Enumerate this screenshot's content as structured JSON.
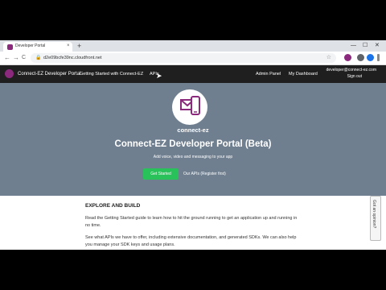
{
  "browser": {
    "tab_title": "Developer Portal",
    "tab_close": "×",
    "new_tab": "+",
    "win_min": "—",
    "win_max": "☐",
    "win_close": "✕",
    "back": "←",
    "forward": "→",
    "reload": "C",
    "url": "d2e09bcfe39nc.cloudfront.net",
    "lock_icon": "🔒",
    "star_icon": "☆"
  },
  "site_nav": {
    "brand": "Connect-EZ Developer Portal",
    "getting_started": "Getting Started with Connect-EZ",
    "apis": "APIs",
    "admin_panel": "Admin Panel",
    "my_dashboard": "My Dashboard",
    "user_email": "developer@connect-ez.com",
    "sign_out": "Sign out"
  },
  "hero": {
    "brand_label": "connect-ez",
    "title": "Connect-EZ Developer Portal (Beta)",
    "subtitle": "Add voice, video and messaging to your app",
    "get_started": "Get Started",
    "apis_link": "Our APIs (Register first)"
  },
  "content": {
    "heading": "EXPLORE AND BUILD",
    "para1": "Read the Getting Started guide to learn how to hit the ground running to get an application up and running in no time.",
    "para2": "See what APIs we have to offer, including extensive documentation, and generated SDKs. We can also help you manage your SDK keys and usage plans."
  },
  "feedback": {
    "label": "Got an opinion?"
  },
  "colors": {
    "brand": "#8b2a7d",
    "hero_bg": "#6f7f90",
    "nav_bg": "#1f1f1f",
    "cta": "#28c15a"
  }
}
